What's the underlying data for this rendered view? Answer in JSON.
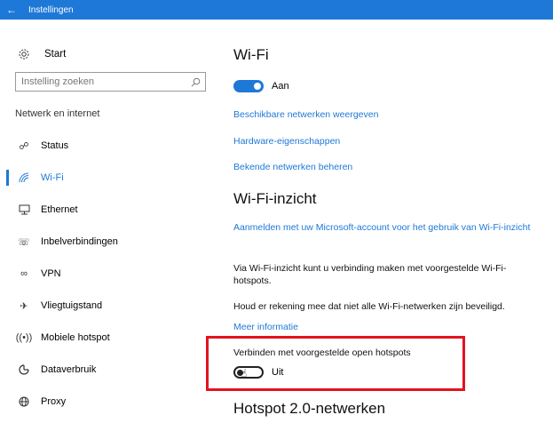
{
  "titlebar": {
    "back_icon": "back-arrow-icon",
    "title": "Instellingen"
  },
  "sidebar": {
    "home_label": "Start",
    "search_placeholder": "Instelling zoeken",
    "section_label": "Netwerk en internet",
    "items": [
      {
        "label": "Status",
        "icon": "globe-status-icon",
        "active": false
      },
      {
        "label": "Wi-Fi",
        "icon": "wifi-icon",
        "active": true
      },
      {
        "label": "Ethernet",
        "icon": "ethernet-icon",
        "active": false
      },
      {
        "label": "Inbelverbindingen",
        "icon": "dialup-icon",
        "active": false
      },
      {
        "label": "VPN",
        "icon": "vpn-icon",
        "active": false
      },
      {
        "label": "Vliegtuigstand",
        "icon": "airplane-icon",
        "active": false
      },
      {
        "label": "Mobiele hotspot",
        "icon": "hotspot-icon",
        "active": false
      },
      {
        "label": "Dataverbruik",
        "icon": "data-usage-icon",
        "active": false
      },
      {
        "label": "Proxy",
        "icon": "proxy-globe-icon",
        "active": false
      }
    ]
  },
  "main": {
    "wifi_heading": "Wi-Fi",
    "wifi_toggle_state": "Aan",
    "links": [
      "Beschikbare netwerken weergeven",
      "Hardware-eigenschappen",
      "Bekende netwerken beheren"
    ],
    "sense_heading": "Wi-Fi-inzicht",
    "sense_link": "Aanmelden met uw Microsoft-account voor het gebruik van Wi-Fi-inzicht",
    "sense_desc": "Via Wi-Fi-inzicht kunt u verbinding maken met voorgestelde Wi-Fi-hotspots.",
    "sense_note": "Houd er rekening mee dat niet alle Wi-Fi-netwerken zijn beveiligd.",
    "more_info": "Meer informatie",
    "connect_label": "Verbinden met voorgestelde open hotspots",
    "connect_toggle_state": "Uit",
    "hotspot_heading": "Hotspot 2.0-netwerken"
  },
  "colors": {
    "accent": "#1e78d7",
    "highlight": "#e4121e"
  }
}
